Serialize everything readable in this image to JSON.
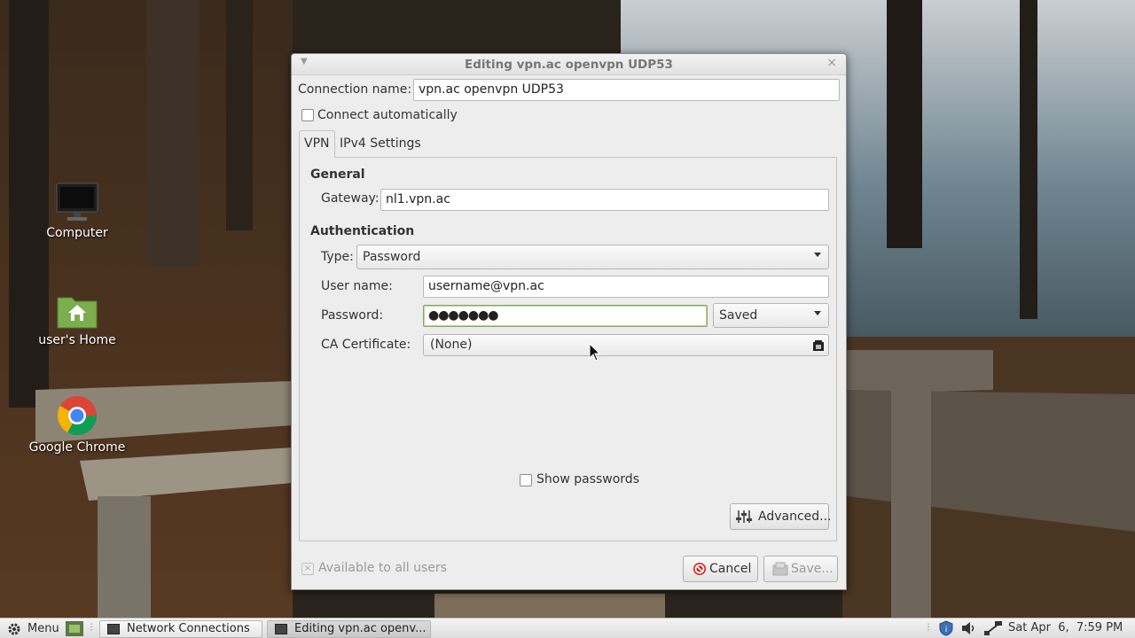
{
  "desktop": {
    "icons": [
      {
        "label": "Computer",
        "icon": "monitor-icon"
      },
      {
        "label": "user's Home",
        "icon": "home-folder-icon"
      },
      {
        "label": "Google Chrome",
        "icon": "chrome-icon"
      }
    ]
  },
  "dialog": {
    "title": "Editing vpn.ac openvpn UDP53",
    "connection_name_label": "Connection name:",
    "connection_name_value": "vpn.ac openvpn UDP53",
    "connect_automatically_label": "Connect automatically",
    "connect_automatically_checked": false,
    "tabs": [
      {
        "label": "VPN",
        "active": true
      },
      {
        "label": "IPv4 Settings",
        "active": false
      }
    ],
    "general": {
      "heading": "General",
      "gateway_label": "Gateway:",
      "gateway_value": "nl1.vpn.ac"
    },
    "authentication": {
      "heading": "Authentication",
      "type_label": "Type:",
      "type_value": "Password",
      "username_label": "User name:",
      "username_value": "username@vpn.ac",
      "password_label": "Password:",
      "password_value": "●●●●●●●",
      "password_storage": "Saved",
      "ca_label": "CA Certificate:",
      "ca_value": "(None)"
    },
    "show_passwords_label": "Show passwords",
    "advanced_label": "Advanced...",
    "available_all_users_label": "Available to all users",
    "cancel_label": "Cancel",
    "save_label": "Save..."
  },
  "taskbar": {
    "menu_label": "Menu",
    "tasks": [
      {
        "label": "Network Connections",
        "active": false
      },
      {
        "label": "Editing vpn.ac openv...",
        "active": true
      }
    ],
    "clock": "Sat Apr  6,  7:59 PM"
  }
}
